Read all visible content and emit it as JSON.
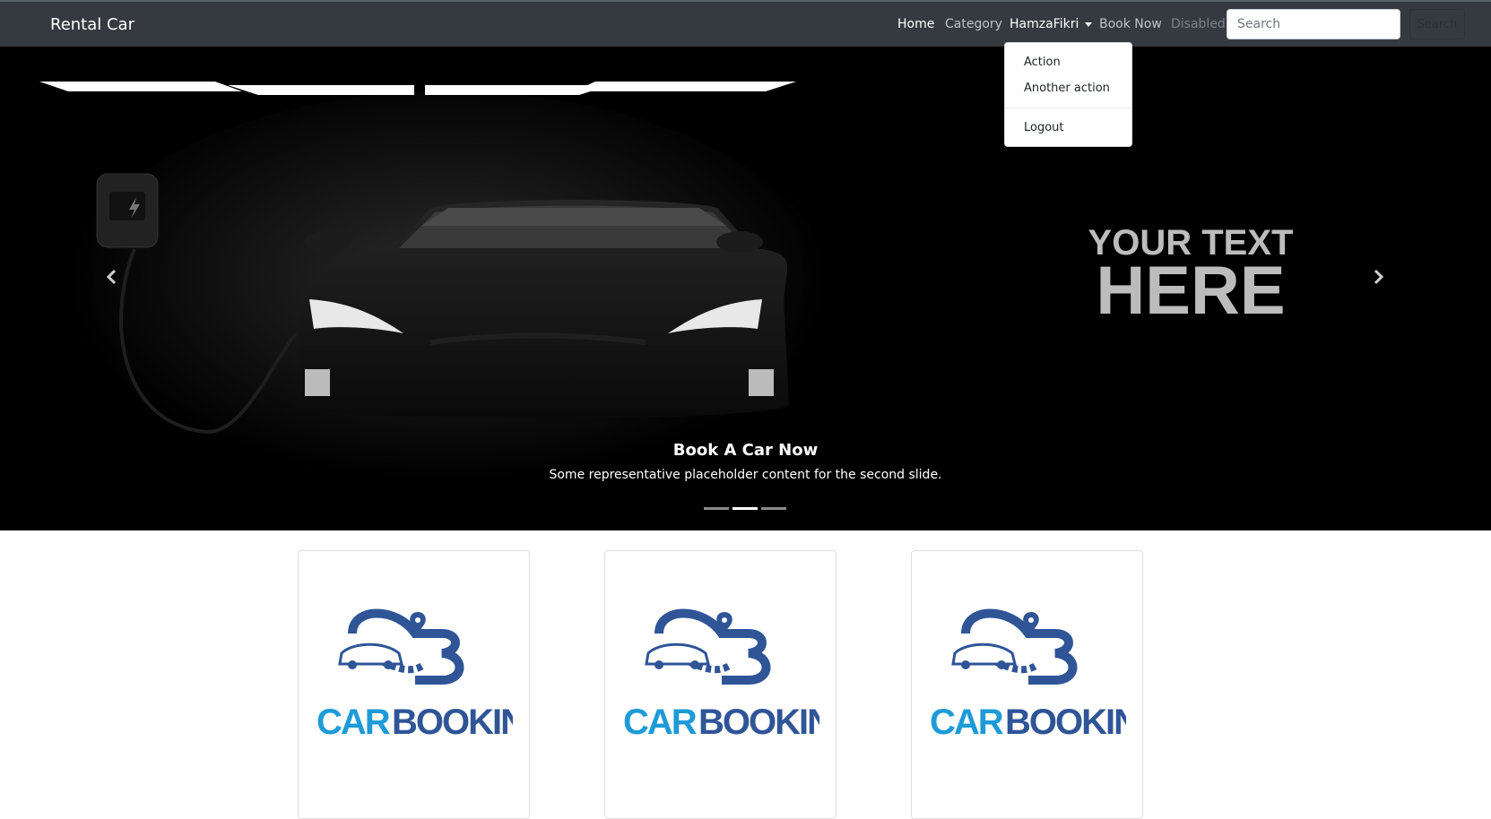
{
  "navbar": {
    "brand": "Rental Car",
    "links": {
      "home": "Home",
      "category": "Category",
      "user": "HamzaFikri",
      "book_now": "Book Now",
      "disabled": "Disabled"
    },
    "search": {
      "placeholder": "Search",
      "button_label": "Search"
    }
  },
  "dropdown": {
    "items": [
      "Action",
      "Another action",
      "Logout"
    ]
  },
  "carousel": {
    "slide_art_text_line1": "YOUR TEXT",
    "slide_art_text_line2": "HERE",
    "caption_title": "Book A Car Now",
    "caption_text": "Some representative placeholder content for the second slide.",
    "prev_icon": "chevron-left-icon",
    "next_icon": "chevron-right-icon",
    "indicator_count": 3,
    "active_indicator": 2
  },
  "cards": [
    {
      "logo_word1": "CAR",
      "logo_word2": "BOOKING"
    },
    {
      "logo_word1": "CAR",
      "logo_word2": "BOOKING"
    },
    {
      "logo_word1": "CAR",
      "logo_word2": "BOOKING"
    }
  ],
  "colors": {
    "navbar_bg": "#343a40",
    "logo_light_blue": "#1e9bd7",
    "logo_dark_blue": "#2f5597"
  }
}
